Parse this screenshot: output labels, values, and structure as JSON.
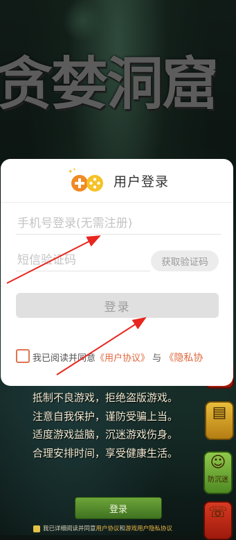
{
  "background": {
    "game_title": "贪婪洞窟",
    "notice_lines": [
      "抵制不良游戏，拒绝盗版游戏。",
      "注意自我保护，谨防受骗上当。",
      "适度游戏益脑，沉迷游戏伤身。",
      "合理安排时间，享受健康生活。"
    ],
    "side_buttons": [
      {
        "icon": "scroll-icon",
        "label": ""
      },
      {
        "icon": "anti-addiction-icon",
        "label": "防沉迷"
      },
      {
        "icon": "customer-service-icon",
        "label": ""
      }
    ],
    "bottom_login_label": "登录",
    "bottom_agreement_prefix": "我已详细阅读并同意",
    "bottom_agreement_link1": "用户协议",
    "bottom_agreement_mid": "和",
    "bottom_agreement_link2": "游戏用户隐私协议"
  },
  "dialog": {
    "title": "用户登录",
    "phone_placeholder": "手机号登录(无需注册)",
    "code_placeholder": "短信验证码",
    "get_code_label": "获取验证码",
    "login_label": "登录",
    "agree_prefix": "我已阅读并同意",
    "user_agreement": "《用户协议》",
    "and": "与",
    "privacy_agreement": "《隐私协"
  },
  "colors": {
    "accent": "#e0673e",
    "button_disabled": "#e0e0e0",
    "logo_orange": "#f08a24",
    "logo_yellow": "#f5c22a"
  }
}
